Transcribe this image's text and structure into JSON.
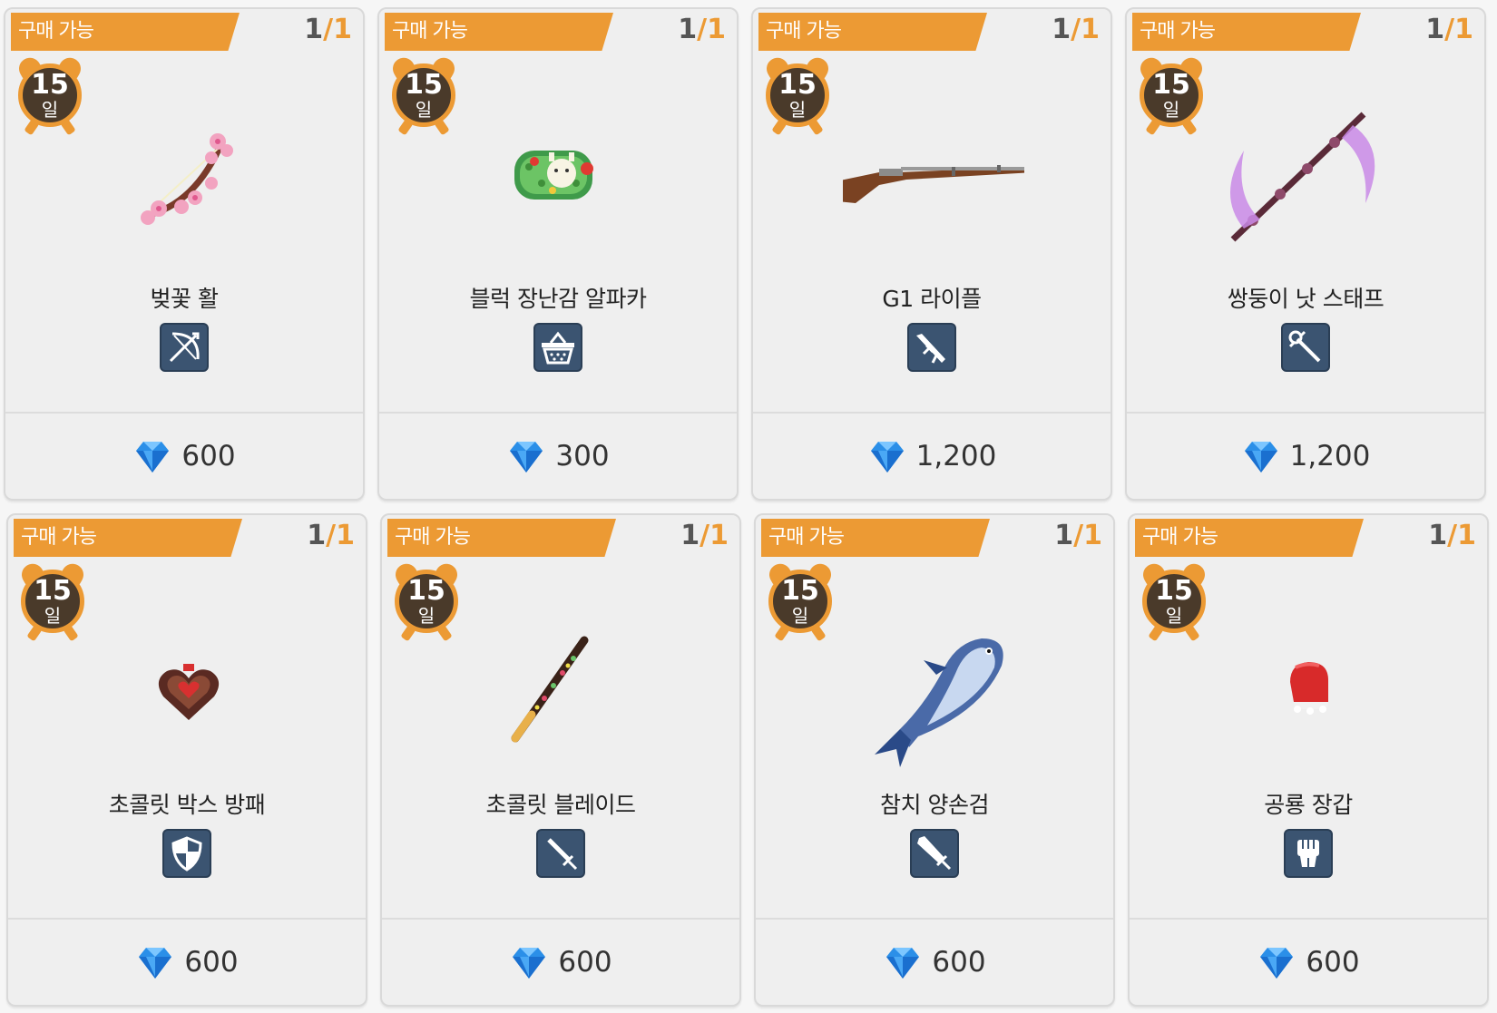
{
  "items": [
    {
      "status": "구매 가능",
      "stock_current": "1",
      "stock_sep": "/",
      "stock_max": "1",
      "days": "15",
      "days_unit": "일",
      "name": "벚꽃 활",
      "category_icon": "bow-icon",
      "image_icon": "cherry-blossom-bow-icon",
      "price": "600"
    },
    {
      "status": "구매 가능",
      "stock_current": "1",
      "stock_sep": "/",
      "stock_max": "1",
      "days": "15",
      "days_unit": "일",
      "name": "블럭 장난감 알파카",
      "category_icon": "basket-icon",
      "image_icon": "alpaca-block-toy-icon",
      "price": "300"
    },
    {
      "status": "구매 가능",
      "stock_current": "1",
      "stock_sep": "/",
      "stock_max": "1",
      "days": "15",
      "days_unit": "일",
      "name": "G1 라이플",
      "category_icon": "rifle-icon",
      "image_icon": "rifle-icon",
      "price": "1,200"
    },
    {
      "status": "구매 가능",
      "stock_current": "1",
      "stock_sep": "/",
      "stock_max": "1",
      "days": "15",
      "days_unit": "일",
      "name": "쌍둥이 낫 스태프",
      "category_icon": "staff-icon",
      "image_icon": "twin-scythe-staff-icon",
      "price": "1,200"
    },
    {
      "status": "구매 가능",
      "stock_current": "1",
      "stock_sep": "/",
      "stock_max": "1",
      "days": "15",
      "days_unit": "일",
      "name": "초콜릿 박스 방패",
      "category_icon": "shield-icon",
      "image_icon": "chocolate-heart-box-icon",
      "price": "600"
    },
    {
      "status": "구매 가능",
      "stock_current": "1",
      "stock_sep": "/",
      "stock_max": "1",
      "days": "15",
      "days_unit": "일",
      "name": "초콜릿 블레이드",
      "category_icon": "sword-icon",
      "image_icon": "chocolate-stick-blade-icon",
      "price": "600"
    },
    {
      "status": "구매 가능",
      "stock_current": "1",
      "stock_sep": "/",
      "stock_max": "1",
      "days": "15",
      "days_unit": "일",
      "name": "참치 양손검",
      "category_icon": "greatsword-icon",
      "image_icon": "tuna-fish-icon",
      "price": "600"
    },
    {
      "status": "구매 가능",
      "stock_current": "1",
      "stock_sep": "/",
      "stock_max": "1",
      "days": "15",
      "days_unit": "일",
      "name": "공룡 장갑",
      "category_icon": "fist-icon",
      "image_icon": "red-glove-icon",
      "price": "600"
    }
  ],
  "currency_icon": "blue-diamond-icon",
  "colors": {
    "ribbon": "#ec9a34",
    "timer_face": "#4a3a2a",
    "category_bg": "#3b5471",
    "gem": "#2b8fe8"
  }
}
